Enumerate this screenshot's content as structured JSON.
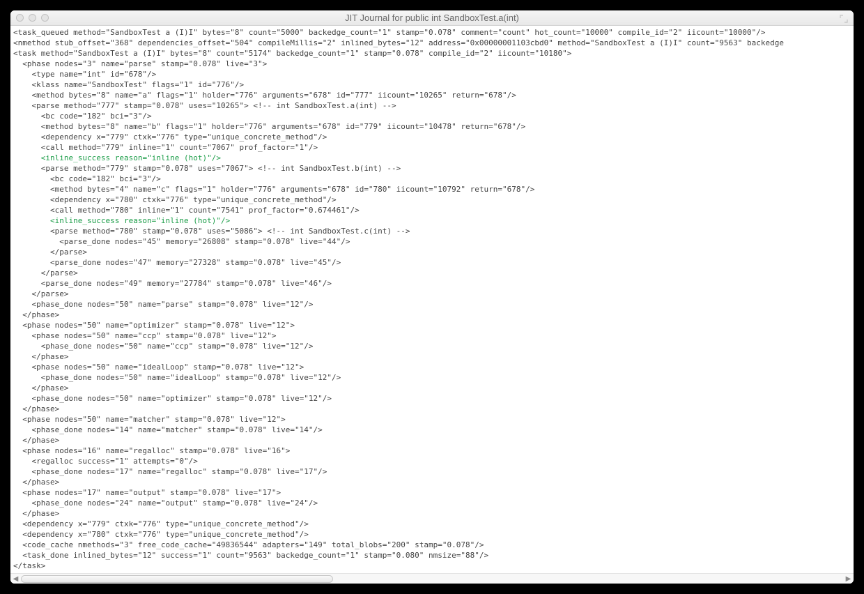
{
  "window": {
    "title": "JIT Journal for public int SandboxTest.a(int)"
  },
  "lines": [
    {
      "indent": 0,
      "hl": false,
      "text": "<task_queued method=\"SandboxTest a (I)I\" bytes=\"8\" count=\"5000\" backedge_count=\"1\" stamp=\"0.078\" comment=\"count\" hot_count=\"10000\" compile_id=\"2\" iicount=\"10000\"/>"
    },
    {
      "indent": 0,
      "hl": false,
      "text": "<nmethod stub_offset=\"368\" dependencies_offset=\"504\" compileMillis=\"2\" inlined_bytes=\"12\" address=\"0x00000001103cbd0\" method=\"SandboxTest a (I)I\" count=\"9563\" backedge"
    },
    {
      "indent": 0,
      "hl": false,
      "text": "<task method=\"SandboxTest a (I)I\" bytes=\"8\" count=\"5174\" backedge_count=\"1\" stamp=\"0.078\" compile_id=\"2\" iicount=\"10180\">"
    },
    {
      "indent": 1,
      "hl": false,
      "text": "<phase nodes=\"3\" name=\"parse\" stamp=\"0.078\" live=\"3\">"
    },
    {
      "indent": 2,
      "hl": false,
      "text": "<type name=\"int\" id=\"678\"/>"
    },
    {
      "indent": 2,
      "hl": false,
      "text": "<klass name=\"SandboxTest\" flags=\"1\" id=\"776\"/>"
    },
    {
      "indent": 2,
      "hl": false,
      "text": "<method bytes=\"8\" name=\"a\" flags=\"1\" holder=\"776\" arguments=\"678\" id=\"777\" iicount=\"10265\" return=\"678\"/>"
    },
    {
      "indent": 2,
      "hl": false,
      "text": "<parse method=\"777\" stamp=\"0.078\" uses=\"10265\"> <!-- int SandboxTest.a(int) -->"
    },
    {
      "indent": 3,
      "hl": false,
      "text": "<bc code=\"182\" bci=\"3\"/>"
    },
    {
      "indent": 3,
      "hl": false,
      "text": "<method bytes=\"8\" name=\"b\" flags=\"1\" holder=\"776\" arguments=\"678\" id=\"779\" iicount=\"10478\" return=\"678\"/>"
    },
    {
      "indent": 3,
      "hl": false,
      "text": "<dependency x=\"779\" ctxk=\"776\" type=\"unique_concrete_method\"/>"
    },
    {
      "indent": 3,
      "hl": false,
      "text": "<call method=\"779\" inline=\"1\" count=\"7067\" prof_factor=\"1\"/>"
    },
    {
      "indent": 3,
      "hl": true,
      "text": "<inline_success reason=\"inline (hot)\"/>"
    },
    {
      "indent": 3,
      "hl": false,
      "text": "<parse method=\"779\" stamp=\"0.078\" uses=\"7067\"> <!-- int SandboxTest.b(int) -->"
    },
    {
      "indent": 4,
      "hl": false,
      "text": "<bc code=\"182\" bci=\"3\"/>"
    },
    {
      "indent": 4,
      "hl": false,
      "text": "<method bytes=\"4\" name=\"c\" flags=\"1\" holder=\"776\" arguments=\"678\" id=\"780\" iicount=\"10792\" return=\"678\"/>"
    },
    {
      "indent": 4,
      "hl": false,
      "text": "<dependency x=\"780\" ctxk=\"776\" type=\"unique_concrete_method\"/>"
    },
    {
      "indent": 4,
      "hl": false,
      "text": "<call method=\"780\" inline=\"1\" count=\"7541\" prof_factor=\"0.674461\"/>"
    },
    {
      "indent": 4,
      "hl": true,
      "text": "<inline_success reason=\"inline (hot)\"/>"
    },
    {
      "indent": 4,
      "hl": false,
      "text": "<parse method=\"780\" stamp=\"0.078\" uses=\"5086\"> <!-- int SandboxTest.c(int) -->"
    },
    {
      "indent": 5,
      "hl": false,
      "text": "<parse_done nodes=\"45\" memory=\"26808\" stamp=\"0.078\" live=\"44\"/>"
    },
    {
      "indent": 4,
      "hl": false,
      "text": "</parse>"
    },
    {
      "indent": 4,
      "hl": false,
      "text": "<parse_done nodes=\"47\" memory=\"27328\" stamp=\"0.078\" live=\"45\"/>"
    },
    {
      "indent": 3,
      "hl": false,
      "text": "</parse>"
    },
    {
      "indent": 3,
      "hl": false,
      "text": "<parse_done nodes=\"49\" memory=\"27784\" stamp=\"0.078\" live=\"46\"/>"
    },
    {
      "indent": 2,
      "hl": false,
      "text": "</parse>"
    },
    {
      "indent": 2,
      "hl": false,
      "text": "<phase_done nodes=\"50\" name=\"parse\" stamp=\"0.078\" live=\"12\"/>"
    },
    {
      "indent": 1,
      "hl": false,
      "text": "</phase>"
    },
    {
      "indent": 1,
      "hl": false,
      "text": "<phase nodes=\"50\" name=\"optimizer\" stamp=\"0.078\" live=\"12\">"
    },
    {
      "indent": 2,
      "hl": false,
      "text": "<phase nodes=\"50\" name=\"ccp\" stamp=\"0.078\" live=\"12\">"
    },
    {
      "indent": 3,
      "hl": false,
      "text": "<phase_done nodes=\"50\" name=\"ccp\" stamp=\"0.078\" live=\"12\"/>"
    },
    {
      "indent": 2,
      "hl": false,
      "text": "</phase>"
    },
    {
      "indent": 2,
      "hl": false,
      "text": "<phase nodes=\"50\" name=\"idealLoop\" stamp=\"0.078\" live=\"12\">"
    },
    {
      "indent": 3,
      "hl": false,
      "text": "<phase_done nodes=\"50\" name=\"idealLoop\" stamp=\"0.078\" live=\"12\"/>"
    },
    {
      "indent": 2,
      "hl": false,
      "text": "</phase>"
    },
    {
      "indent": 2,
      "hl": false,
      "text": "<phase_done nodes=\"50\" name=\"optimizer\" stamp=\"0.078\" live=\"12\"/>"
    },
    {
      "indent": 1,
      "hl": false,
      "text": "</phase>"
    },
    {
      "indent": 1,
      "hl": false,
      "text": "<phase nodes=\"50\" name=\"matcher\" stamp=\"0.078\" live=\"12\">"
    },
    {
      "indent": 2,
      "hl": false,
      "text": "<phase_done nodes=\"14\" name=\"matcher\" stamp=\"0.078\" live=\"14\"/>"
    },
    {
      "indent": 1,
      "hl": false,
      "text": "</phase>"
    },
    {
      "indent": 1,
      "hl": false,
      "text": "<phase nodes=\"16\" name=\"regalloc\" stamp=\"0.078\" live=\"16\">"
    },
    {
      "indent": 2,
      "hl": false,
      "text": "<regalloc success=\"1\" attempts=\"0\"/>"
    },
    {
      "indent": 2,
      "hl": false,
      "text": "<phase_done nodes=\"17\" name=\"regalloc\" stamp=\"0.078\" live=\"17\"/>"
    },
    {
      "indent": 1,
      "hl": false,
      "text": "</phase>"
    },
    {
      "indent": 1,
      "hl": false,
      "text": "<phase nodes=\"17\" name=\"output\" stamp=\"0.078\" live=\"17\">"
    },
    {
      "indent": 2,
      "hl": false,
      "text": "<phase_done nodes=\"24\" name=\"output\" stamp=\"0.078\" live=\"24\"/>"
    },
    {
      "indent": 1,
      "hl": false,
      "text": "</phase>"
    },
    {
      "indent": 1,
      "hl": false,
      "text": "<dependency x=\"779\" ctxk=\"776\" type=\"unique_concrete_method\"/>"
    },
    {
      "indent": 1,
      "hl": false,
      "text": "<dependency x=\"780\" ctxk=\"776\" type=\"unique_concrete_method\"/>"
    },
    {
      "indent": 1,
      "hl": false,
      "text": "<code_cache nmethods=\"3\" free_code_cache=\"49836544\" adapters=\"149\" total_blobs=\"200\" stamp=\"0.078\"/>"
    },
    {
      "indent": 1,
      "hl": false,
      "text": "<task_done inlined_bytes=\"12\" success=\"1\" count=\"9563\" backedge_count=\"1\" stamp=\"0.080\" nmsize=\"88\"/>"
    },
    {
      "indent": 0,
      "hl": false,
      "text": "</task>"
    }
  ]
}
